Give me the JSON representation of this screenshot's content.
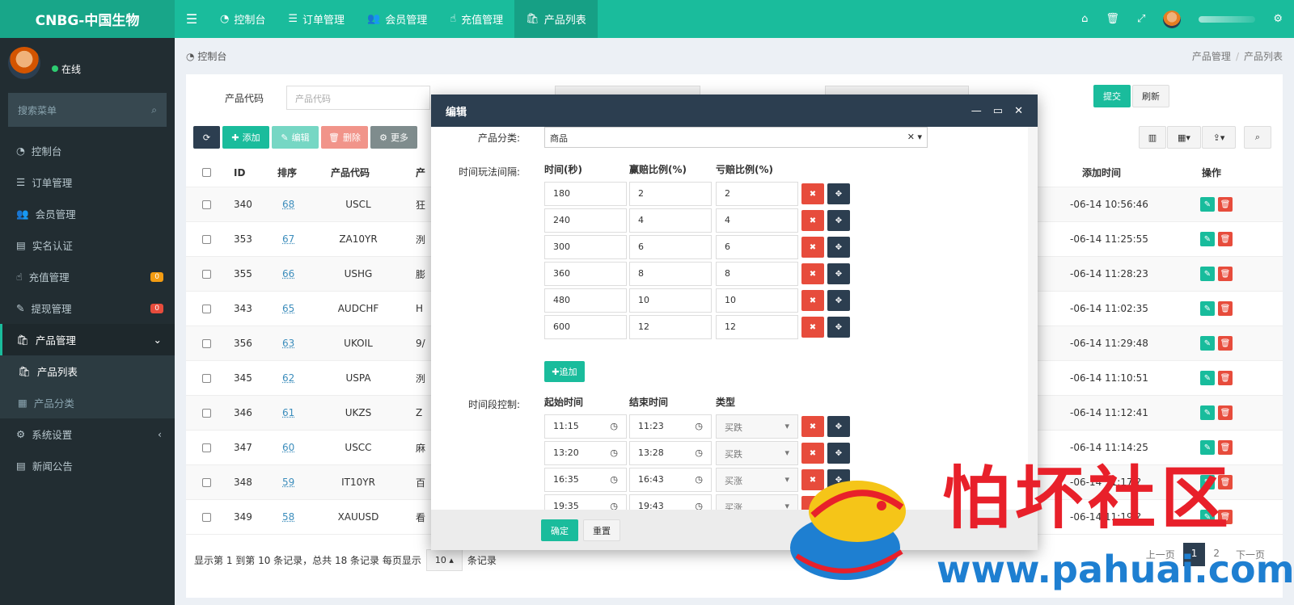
{
  "app": {
    "brand": "CNBG-中国生物",
    "online": "在线",
    "user_name": ""
  },
  "topnav": [
    {
      "icon": "dashboard-icon",
      "glyph": "◔",
      "label": "控制台"
    },
    {
      "icon": "list-icon",
      "glyph": "☰",
      "label": "订单管理"
    },
    {
      "icon": "users-icon",
      "glyph": "👥",
      "label": "会员管理"
    },
    {
      "icon": "hand-icon",
      "glyph": "☝",
      "label": "充值管理"
    },
    {
      "icon": "bag-icon",
      "glyph": "🛍",
      "label": "产品列表"
    }
  ],
  "sidebar": {
    "search_placeholder": "搜索菜单",
    "items": [
      {
        "label": "控制台",
        "glyph": "◔"
      },
      {
        "label": "订单管理",
        "glyph": "☰"
      },
      {
        "label": "会员管理",
        "glyph": "👥"
      },
      {
        "label": "实名认证",
        "glyph": "▤"
      },
      {
        "label": "充值管理",
        "glyph": "☝",
        "badge": "0",
        "badge_color": "#f39c12"
      },
      {
        "label": "提现管理",
        "glyph": "✎",
        "badge": "0",
        "badge_color": "#e74c3c"
      },
      {
        "label": "产品管理",
        "glyph": "🛍",
        "open": true
      },
      {
        "label": "产品列表",
        "glyph": "🛍",
        "sub": true,
        "active": true
      },
      {
        "label": "产品分类",
        "glyph": "▦",
        "sub": true
      },
      {
        "label": "系统设置",
        "glyph": "⚙"
      },
      {
        "label": "新闻公告",
        "glyph": "▤"
      }
    ]
  },
  "breadcrumb": {
    "left": "控制台",
    "right": [
      "产品管理",
      "产品列表"
    ]
  },
  "filter": {
    "label": "产品代码",
    "placeholder": "产品代码",
    "submit": "提交",
    "refresh": "刷新"
  },
  "toolbar": {
    "add": "添加",
    "edit": "编辑",
    "delete": "删除",
    "more": "更多"
  },
  "table": {
    "headers": [
      "ID",
      "排序",
      "产品代码",
      "产",
      "添加时间",
      "操作"
    ],
    "rows": [
      {
        "id": "340",
        "sort": "68",
        "code": "USCL",
        "name": "狂",
        "time": "-06-14 10:56:46"
      },
      {
        "id": "353",
        "sort": "67",
        "code": "ZA10YR",
        "name": "洌",
        "time": "-06-14 11:25:55"
      },
      {
        "id": "355",
        "sort": "66",
        "code": "USHG",
        "name": "膨",
        "time": "-06-14 11:28:23"
      },
      {
        "id": "343",
        "sort": "65",
        "code": "AUDCHF",
        "name": "H",
        "time": "-06-14 11:02:35"
      },
      {
        "id": "356",
        "sort": "63",
        "code": "UKOIL",
        "name": "9/",
        "time": "-06-14 11:29:48"
      },
      {
        "id": "345",
        "sort": "62",
        "code": "USPA",
        "name": "洌",
        "time": "-06-14 11:10:51"
      },
      {
        "id": "346",
        "sort": "61",
        "code": "UKZS",
        "name": "Z",
        "time": "-06-14 11:12:41"
      },
      {
        "id": "347",
        "sort": "60",
        "code": "USCC",
        "name": "麻",
        "time": "-06-14 11:14:25"
      },
      {
        "id": "348",
        "sort": "59",
        "code": "IT10YR",
        "name": "百",
        "time": "-06-14 11:17:?"
      },
      {
        "id": "349",
        "sort": "58",
        "code": "XAUUSD",
        "name": "看",
        "time": "-06-14 11:19:?"
      }
    ]
  },
  "footer": {
    "info": "显示第 1 到第 10 条记录，总共 18 条记录 每页显示",
    "page_size": "10 ▴",
    "suffix": "条记录",
    "prev": "上一页",
    "pages": [
      "1",
      "2"
    ],
    "next": "下一页"
  },
  "modal": {
    "title": "编辑",
    "category_label": "产品分类:",
    "category_value": "商品",
    "interval_label": "时间玩法间隔:",
    "interval_headers": [
      "时间(秒)",
      "赢赔比例(%)",
      "亏赔比例(%)"
    ],
    "intervals": [
      [
        "180",
        "2",
        "2"
      ],
      [
        "240",
        "4",
        "4"
      ],
      [
        "300",
        "6",
        "6"
      ],
      [
        "360",
        "8",
        "8"
      ],
      [
        "480",
        "10",
        "10"
      ],
      [
        "600",
        "12",
        "12"
      ]
    ],
    "add_label": "追加",
    "period_label": "时间段控制:",
    "period_headers": [
      "起始时间",
      "结束时间",
      "类型"
    ],
    "periods": [
      [
        "11:15",
        "11:23",
        "买跌"
      ],
      [
        "13:20",
        "13:28",
        "买跌"
      ],
      [
        "16:35",
        "16:43",
        "买涨"
      ],
      [
        "19:35",
        "19:43",
        "买涨"
      ]
    ],
    "ok": "确定",
    "reset": "重置"
  },
  "watermark": {
    "text": "怕坏社区",
    "url": "www.pahuai.com"
  },
  "colors": {
    "accent": "#1abc9c",
    "sidebar": "#222d32",
    "modal_header": "#2c3e50",
    "danger": "#e74c3c"
  }
}
